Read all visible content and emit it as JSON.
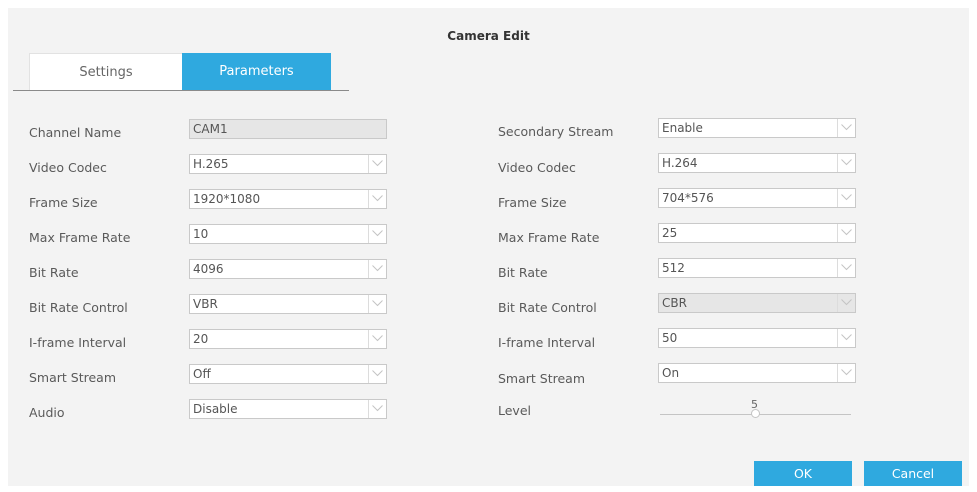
{
  "dialog": {
    "title": "Camera Edit"
  },
  "tabs": [
    {
      "label": "Settings",
      "active": false
    },
    {
      "label": "Parameters",
      "active": true
    }
  ],
  "main_stream": {
    "channel_name": {
      "label": "Channel Name",
      "value": "CAM1"
    },
    "video_codec": {
      "label": "Video Codec",
      "value": "H.265"
    },
    "frame_size": {
      "label": "Frame Size",
      "value": "1920*1080"
    },
    "max_frame_rate": {
      "label": "Max Frame Rate",
      "value": "10"
    },
    "bit_rate": {
      "label": "Bit Rate",
      "value": "4096"
    },
    "bit_rate_control": {
      "label": "Bit Rate Control",
      "value": "VBR"
    },
    "iframe_interval": {
      "label": "I-frame Interval",
      "value": "20"
    },
    "smart_stream": {
      "label": "Smart Stream",
      "value": "Off"
    },
    "audio": {
      "label": "Audio",
      "value": "Disable"
    }
  },
  "secondary_stream": {
    "secondary_stream": {
      "label": "Secondary Stream",
      "value": "Enable"
    },
    "video_codec": {
      "label": "Video Codec",
      "value": "H.264"
    },
    "frame_size": {
      "label": "Frame Size",
      "value": "704*576"
    },
    "max_frame_rate": {
      "label": "Max Frame Rate",
      "value": "25"
    },
    "bit_rate": {
      "label": "Bit Rate",
      "value": "512"
    },
    "bit_rate_control": {
      "label": "Bit Rate Control",
      "value": "CBR"
    },
    "iframe_interval": {
      "label": "I-frame Interval",
      "value": "50"
    },
    "smart_stream": {
      "label": "Smart Stream",
      "value": "On"
    },
    "level": {
      "label": "Level",
      "value": "5",
      "fraction": 0.5
    }
  },
  "buttons": {
    "ok": "OK",
    "cancel": "Cancel"
  },
  "colors": {
    "accent": "#2fa9df",
    "panel": "#f3f3f3"
  }
}
